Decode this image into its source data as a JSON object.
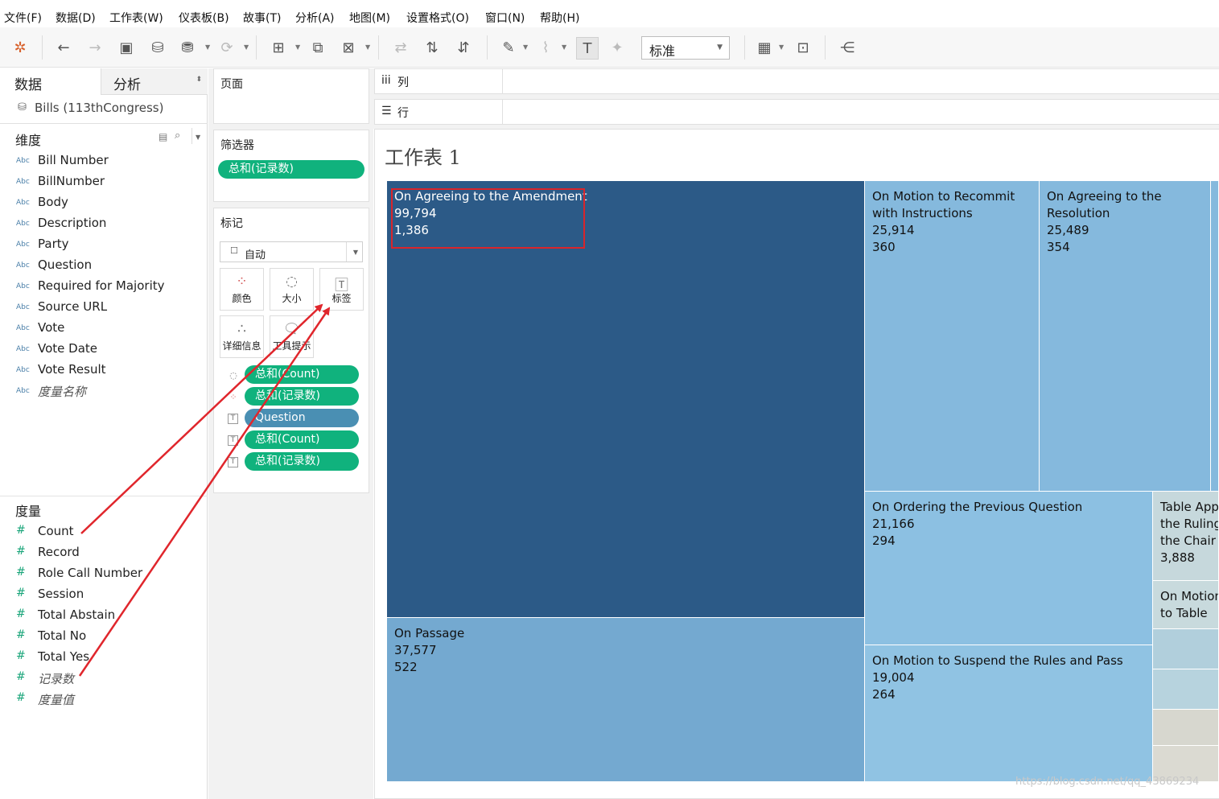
{
  "menu": [
    "文件(F)",
    "数据(D)",
    "工作表(W)",
    "仪表板(B)",
    "故事(T)",
    "分析(A)",
    "地图(M)",
    "设置格式(O)",
    "窗口(N)",
    "帮助(H)"
  ],
  "toolbar": {
    "select_value": "标准"
  },
  "data_pane": {
    "tab_data": "数据",
    "tab_analysis": "分析",
    "source": "Bills (113thCongress)",
    "dimensions_title": "维度",
    "dimensions": [
      "Bill Number",
      "BillNumber",
      "Body",
      "Description",
      "Party",
      "Question",
      "Required for Majority",
      "Source URL",
      "Vote",
      "Vote Date",
      "Vote Result",
      "度量名称"
    ],
    "dim_type": "Abc",
    "measures_title": "度量",
    "measures": [
      "Count",
      "Record",
      "Role Call Number",
      "Session",
      "Total Abstain",
      "Total No",
      "Total Yes",
      "记录数",
      "度量值"
    ],
    "measure_type": "#"
  },
  "pages": {
    "title": "页面"
  },
  "filters": {
    "title": "筛选器",
    "pill": "总和(记录数)"
  },
  "marks": {
    "title": "标记",
    "type_value": "自动",
    "buttons": {
      "color": "颜色",
      "size": "大小",
      "label": "标签",
      "detail": "详细信息",
      "tooltip": "工具提示"
    },
    "pills": [
      "总和(Count)",
      "总和(记录数)",
      "Question",
      "总和(Count)",
      "总和(记录数)"
    ]
  },
  "shelves": {
    "columns": "列",
    "rows": "行"
  },
  "sheet": {
    "title": "工作表 1"
  },
  "treemap": [
    {
      "label": "On Agreeing to the Amendment",
      "count": "99,794",
      "records": "1,386",
      "color": "#2c5a87"
    },
    {
      "label": "On Passage",
      "count": "37,577",
      "records": "522",
      "color": "#74a9d0"
    },
    {
      "label": "On Motion to Recommit with Instructions",
      "count": "25,914",
      "records": "360",
      "color": "#85b9dd"
    },
    {
      "label": "On Agreeing to the Resolution",
      "count": "25,489",
      "records": "354",
      "color": "#85b9dd"
    },
    {
      "label": "On Ordering the Previous Question",
      "count": "21,166",
      "records": "294",
      "color": "#8cc0e2"
    },
    {
      "label": "On Motion to Suspend the Rules and Pass",
      "count": "19,004",
      "records": "264",
      "color": "#90c3e3"
    },
    {
      "label": "Table Appeal of the Ruling of the Chair",
      "count": "3,888",
      "records": "",
      "color": "#c6d8dc"
    },
    {
      "label": "On Motion to Table",
      "count": "",
      "records": "",
      "color": "#c8dadd"
    }
  ],
  "watermark": "https://blog.csdn.net/qq_43869234"
}
